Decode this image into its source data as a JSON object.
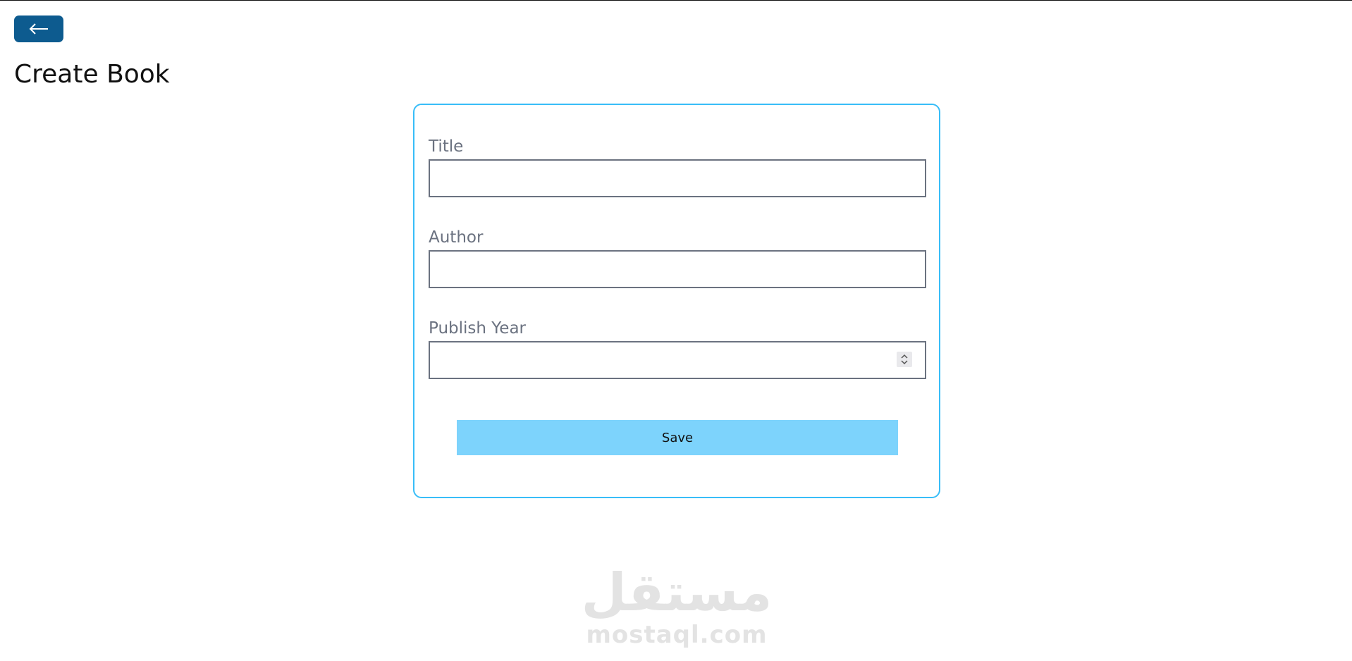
{
  "header": {
    "back_button_icon": "arrow-left-icon",
    "title": "Create Book"
  },
  "form": {
    "title_label": "Title",
    "title_value": "",
    "author_label": "Author",
    "author_value": "",
    "publish_year_label": "Publish Year",
    "publish_year_value": "",
    "save_label": "Save"
  },
  "watermark": {
    "logo_text": "مستقل",
    "site": "mostaql.com"
  },
  "colors": {
    "back_button": "#0d5b8f",
    "card_border": "#38bdf8",
    "save_button": "#7dd3fc",
    "label_text": "#6b7280"
  }
}
